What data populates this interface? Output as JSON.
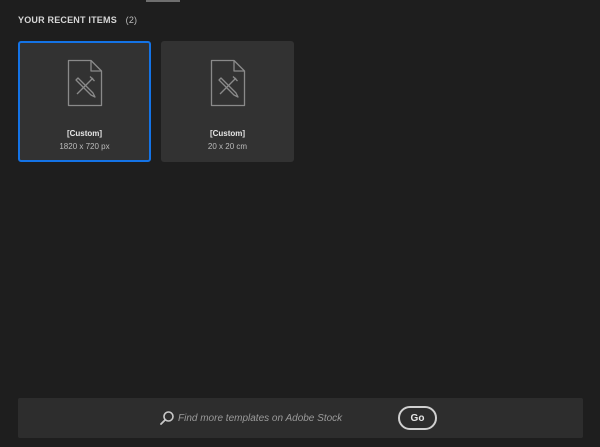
{
  "recent": {
    "title": "YOUR RECENT ITEMS",
    "count": "(2)",
    "items": [
      {
        "name": "[Custom]",
        "size": "1820 x 720 px",
        "icon": "document-pen-icon",
        "selected": true
      },
      {
        "name": "[Custom]",
        "size": "20 x 20 cm",
        "icon": "document-pen-icon",
        "selected": false
      }
    ]
  },
  "search": {
    "icon": "search-icon",
    "placeholder": "Find more templates on Adobe Stock",
    "value": ""
  },
  "go_button": {
    "label": "Go"
  },
  "colors": {
    "background": "#1e1e1e",
    "card": "#323232",
    "accent": "#1473e6",
    "bottom_bar": "#2d2d2d"
  }
}
